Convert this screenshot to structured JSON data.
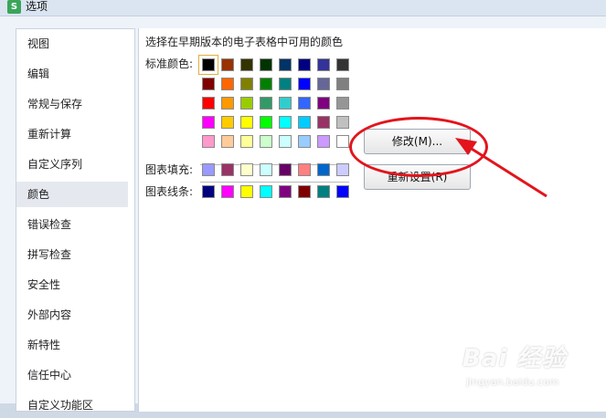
{
  "window": {
    "title": "选项",
    "app_icon_letter": "S"
  },
  "sidebar": {
    "items": [
      {
        "label": "视图"
      },
      {
        "label": "编辑"
      },
      {
        "label": "常规与保存"
      },
      {
        "label": "重新计算"
      },
      {
        "label": "自定义序列"
      },
      {
        "label": "颜色",
        "selected": true
      },
      {
        "label": "错误检查"
      },
      {
        "label": "拼写检查"
      },
      {
        "label": "安全性"
      },
      {
        "label": "外部内容"
      },
      {
        "label": "新特性"
      },
      {
        "label": "信任中心"
      },
      {
        "label": "自定义功能区"
      }
    ]
  },
  "content": {
    "heading": "选择在早期版本的电子表格中可用的颜色",
    "standard_label": "标准颜色:",
    "chart_fill_label": "图表填充:",
    "chart_line_label": "图表线条:",
    "standard_colors": [
      [
        "#000000",
        "#993300",
        "#333300",
        "#003300",
        "#003366",
        "#000080",
        "#333399",
        "#333333"
      ],
      [
        "#800000",
        "#FF6600",
        "#808000",
        "#008000",
        "#008080",
        "#0000FF",
        "#666699",
        "#808080"
      ],
      [
        "#FF0000",
        "#FF9900",
        "#99CC00",
        "#339966",
        "#33CCCC",
        "#3366FF",
        "#800080",
        "#969696"
      ],
      [
        "#FF00FF",
        "#FFCC00",
        "#FFFF00",
        "#00FF00",
        "#00FFFF",
        "#00CCFF",
        "#993366",
        "#C0C0C0"
      ],
      [
        "#FF99CC",
        "#FFCC99",
        "#FFFF99",
        "#CCFFCC",
        "#CCFFFF",
        "#99CCFF",
        "#CC99FF",
        "#FFFFFF"
      ]
    ],
    "chart_fill_colors": [
      "#9999FF",
      "#993366",
      "#FFFFCC",
      "#CCFFFF",
      "#660066",
      "#FF8080",
      "#0066CC",
      "#CCCCFF"
    ],
    "chart_line_colors": [
      "#000080",
      "#FF00FF",
      "#FFFF00",
      "#00FFFF",
      "#800080",
      "#800000",
      "#008080",
      "#0000FF"
    ],
    "modify_button": "修改(M)...",
    "reset_button": "重新设置(R)"
  },
  "annotation": {
    "color": "#E3141C"
  },
  "watermark": {
    "main": "Bai 经验",
    "sub": "jingyan.baidu.com"
  }
}
